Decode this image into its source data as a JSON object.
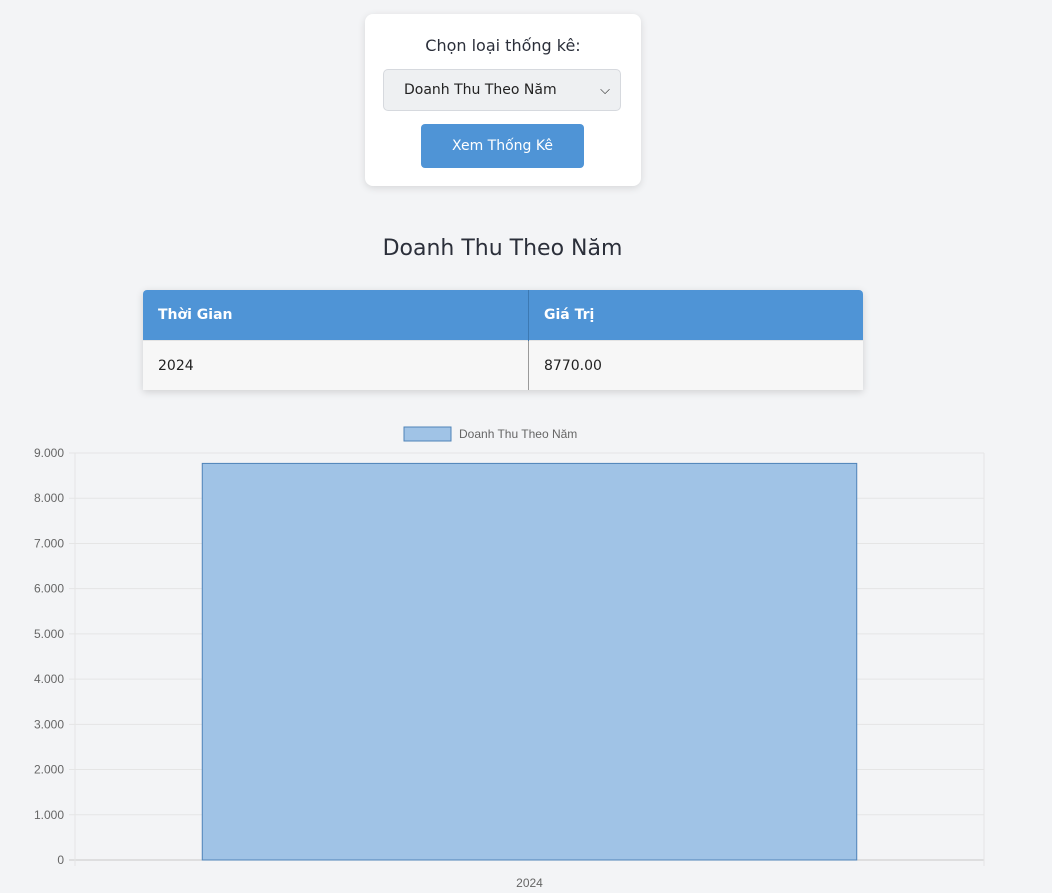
{
  "selector": {
    "label": "Chọn loại thống kê:",
    "selected_option": "Doanh Thu Theo Năm",
    "button_label": "Xem Thống Kê"
  },
  "section_title": "Doanh Thu Theo Năm",
  "table": {
    "headers": [
      "Thời Gian",
      "Giá Trị"
    ],
    "rows": [
      [
        "2024",
        "8770.00"
      ]
    ]
  },
  "chart_data": {
    "type": "bar",
    "categories": [
      "2024"
    ],
    "series": [
      {
        "name": "Doanh Thu Theo Năm",
        "values": [
          8770
        ]
      }
    ],
    "ylim": [
      0,
      9000
    ],
    "yticks": [
      "0",
      "1.000",
      "2.000",
      "3.000",
      "4.000",
      "5.000",
      "6.000",
      "7.000",
      "8.000",
      "9.000"
    ],
    "legend": "top",
    "grid": true,
    "bar_color": "#a0c3e6",
    "bar_border_color": "#4f83b8"
  }
}
